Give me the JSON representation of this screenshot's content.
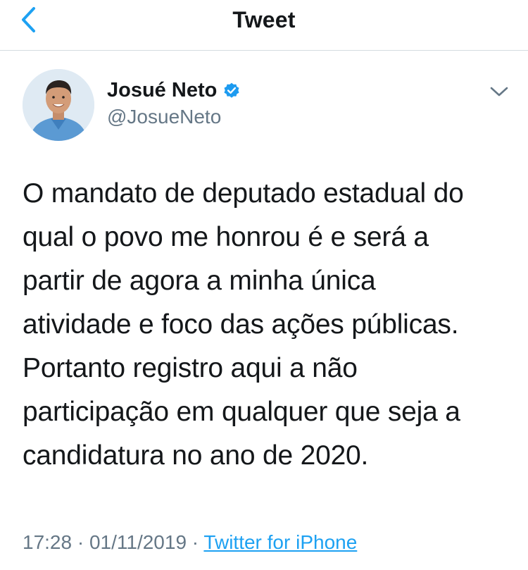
{
  "nav": {
    "title": "Tweet",
    "back_icon": "chevron-left-icon"
  },
  "author": {
    "display_name": "Josué Neto",
    "handle": "@JosueNeto",
    "verified_icon": "verified-badge-icon",
    "menu_icon": "chevron-down-icon"
  },
  "tweet": {
    "text": "O mandato de deputado estadual do\nqual o povo me honrou é e será a\npartir de agora a minha única\natividade e foco das ações públicas.\nPortanto registro aqui a não\nparticipação em qualquer que seja a\ncandidatura no ano de 2020."
  },
  "meta": {
    "time": "17:28",
    "separator1": " · ",
    "date": "01/11/2019",
    "separator2": " · ",
    "source": "Twitter for iPhone"
  },
  "colors": {
    "accent": "#1da1f2",
    "text_primary": "#14171a",
    "text_secondary": "#657786",
    "verified": "#1d9bf0",
    "divider": "#d5dbe0"
  }
}
